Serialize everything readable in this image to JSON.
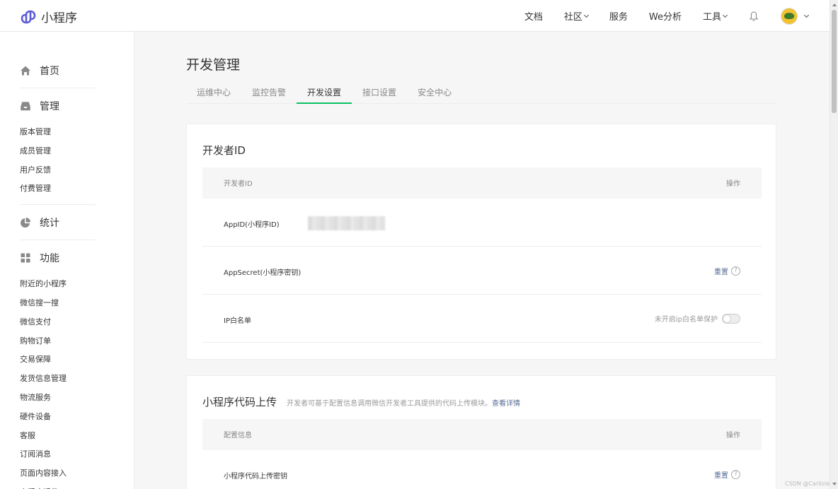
{
  "app": {
    "name": "小程序"
  },
  "topnav": {
    "items": [
      {
        "label": "文档",
        "dropdown": false
      },
      {
        "label": "社区",
        "dropdown": true
      },
      {
        "label": "服务",
        "dropdown": false
      },
      {
        "label": "We分析",
        "dropdown": false
      },
      {
        "label": "工具",
        "dropdown": true
      }
    ]
  },
  "sidebar": {
    "home": {
      "label": "首页",
      "icon": "home-icon"
    },
    "manage": {
      "label": "管理",
      "icon": "inbox-icon",
      "items": [
        "版本管理",
        "成员管理",
        "用户反馈",
        "付费管理"
      ]
    },
    "stats": {
      "label": "统计",
      "icon": "pie-chart-icon"
    },
    "features": {
      "label": "功能",
      "icon": "grid-icon",
      "items": [
        "附近的小程序",
        "微信搜一搜",
        "微信支付",
        "购物订单",
        "交易保障",
        "发货信息管理",
        "物流服务",
        "硬件设备",
        "客服",
        "订阅消息",
        "页面内容接入",
        "小程序插件"
      ]
    }
  },
  "page": {
    "title": "开发管理",
    "tabs": [
      "运维中心",
      "监控告警",
      "开发设置",
      "接口设置",
      "安全中心"
    ],
    "active_tab": "开发设置"
  },
  "dev_id_card": {
    "title": "开发者ID",
    "header": {
      "col1": "开发者ID",
      "col2": "操作"
    },
    "rows": {
      "appid": {
        "label": "AppID(小程序ID)"
      },
      "appsecret": {
        "label": "AppSecret(小程序密钥)",
        "action": "重置",
        "help": "?"
      },
      "ip": {
        "label": "IP白名单",
        "toggle_text": "未开启ip白名单保护",
        "toggle_on": false
      }
    }
  },
  "upload_card": {
    "title": "小程序代码上传",
    "desc": "开发者可基于配置信息调用微信开发者工具提供的代码上传模块。",
    "link": "查看详情",
    "header": {
      "col1": "配置信息",
      "col2": "操作"
    },
    "row": {
      "label": "小程序代码上传密钥",
      "action": "重置",
      "help": "?"
    }
  },
  "watermark": "CSDN @Carlisle",
  "colors": {
    "accent": "#07c160",
    "link": "#576b95",
    "brand_logo": "#5b5bd6"
  }
}
